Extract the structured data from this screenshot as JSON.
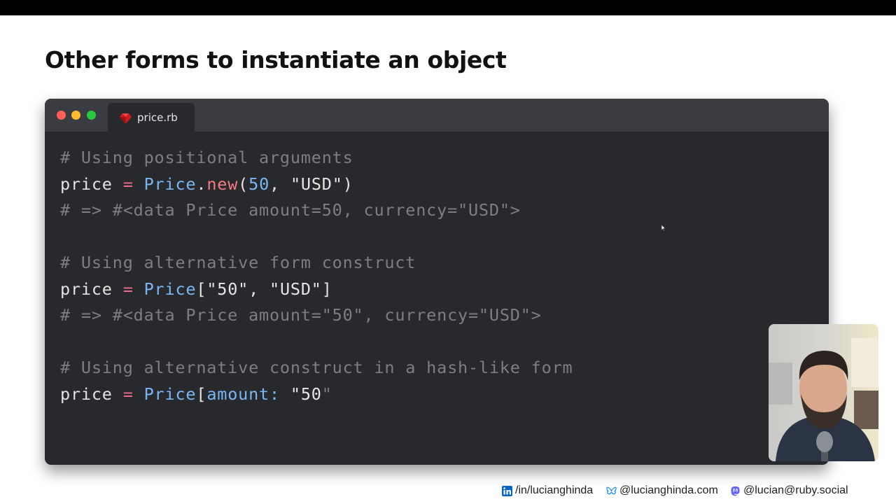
{
  "slide": {
    "title": "Other forms to instantiate an object"
  },
  "editor": {
    "tab_filename": "price.rb",
    "window_controls": [
      "close",
      "minimize",
      "maximize"
    ],
    "lines": [
      [
        {
          "t": "# Using positional arguments",
          "c": "cm"
        }
      ],
      [
        {
          "t": "price",
          "c": "pn"
        },
        {
          "t": " ",
          "c": "pn"
        },
        {
          "t": "=",
          "c": "op"
        },
        {
          "t": " ",
          "c": "pn"
        },
        {
          "t": "Price",
          "c": "cls"
        },
        {
          "t": ".",
          "c": "pn"
        },
        {
          "t": "new",
          "c": "mth"
        },
        {
          "t": "(",
          "c": "pn"
        },
        {
          "t": "50",
          "c": "num"
        },
        {
          "t": ", ",
          "c": "pn"
        },
        {
          "t": "\"USD\"",
          "c": "str"
        },
        {
          "t": ")",
          "c": "pn"
        }
      ],
      [
        {
          "t": "# => #<data Price amount=50, currency=\"USD\">",
          "c": "cm"
        }
      ],
      [],
      [
        {
          "t": "# Using alternative form construct",
          "c": "cm"
        }
      ],
      [
        {
          "t": "price",
          "c": "pn"
        },
        {
          "t": " ",
          "c": "pn"
        },
        {
          "t": "=",
          "c": "op"
        },
        {
          "t": " ",
          "c": "pn"
        },
        {
          "t": "Price",
          "c": "cls"
        },
        {
          "t": "[",
          "c": "pn"
        },
        {
          "t": "\"50\"",
          "c": "str"
        },
        {
          "t": ", ",
          "c": "pn"
        },
        {
          "t": "\"USD\"",
          "c": "str"
        },
        {
          "t": "]",
          "c": "pn"
        }
      ],
      [
        {
          "t": "# => #<data Price amount=\"50\", currency=\"USD\">",
          "c": "cm"
        }
      ],
      [],
      [
        {
          "t": "# Using alternative construct in a hash-like form",
          "c": "cm"
        }
      ],
      [
        {
          "t": "price",
          "c": "pn"
        },
        {
          "t": " ",
          "c": "pn"
        },
        {
          "t": "=",
          "c": "op"
        },
        {
          "t": " ",
          "c": "pn"
        },
        {
          "t": "Price",
          "c": "cls"
        },
        {
          "t": "[",
          "c": "pn"
        },
        {
          "t": "amount: ",
          "c": "cls"
        },
        {
          "t": "\"50",
          "c": "str"
        },
        {
          "t": "\"",
          "c": "typing"
        }
      ]
    ]
  },
  "footer": {
    "linkedin": "/in/lucianghinda",
    "bluesky": "@lucianghinda.com",
    "mastodon": "@lucian@ruby.social"
  },
  "colors": {
    "editor_bg": "#27292d",
    "titlebar_bg": "#3a3c41",
    "comment": "#7d7e82",
    "operator": "#f06a8f",
    "class_name": "#7ab7f2",
    "method": "#f77a7f",
    "linkedin_blue": "#0a66c2",
    "bluesky_blue": "#1185fe",
    "mastodon_purple": "#6364ff"
  },
  "icons": [
    "ruby-file-icon",
    "linkedin-icon",
    "bluesky-icon",
    "mastodon-icon",
    "mouse-pointer-icon"
  ]
}
